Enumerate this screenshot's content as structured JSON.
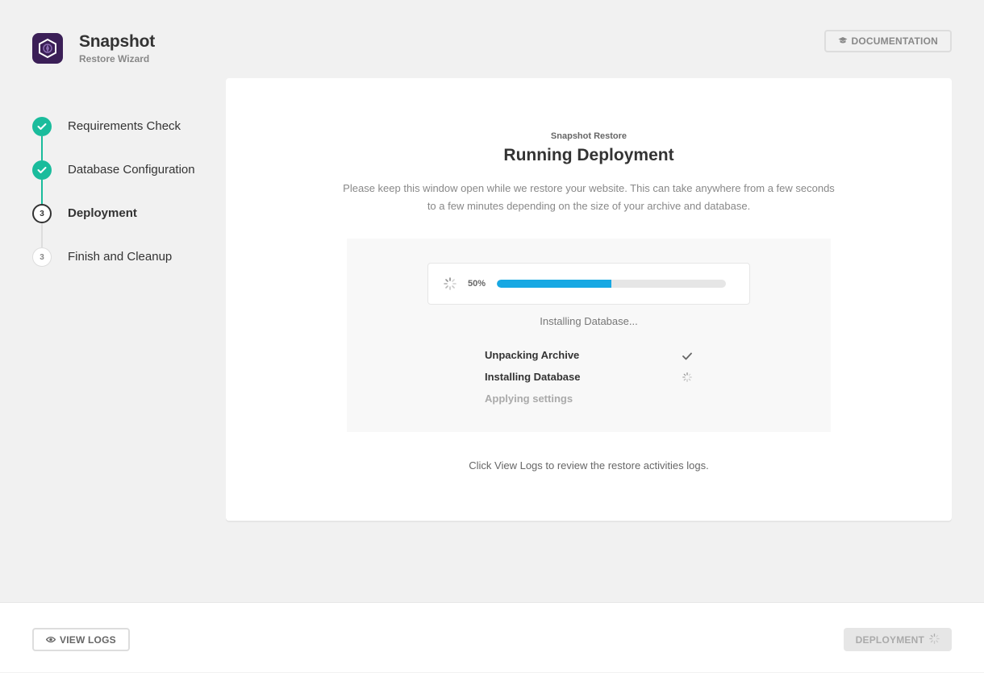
{
  "brand": {
    "name": "Snapshot",
    "subtitle": "Restore Wizard",
    "logo_icon": "snapshot-logo-icon",
    "logo_color": "#3b1f57"
  },
  "header": {
    "documentation_label": "DOCUMENTATION",
    "documentation_icon": "graduation-cap-icon"
  },
  "steps": [
    {
      "label": "Requirements Check",
      "status": "done",
      "marker": "check"
    },
    {
      "label": "Database Configuration",
      "status": "done",
      "marker": "check"
    },
    {
      "label": "Deployment",
      "status": "current",
      "marker": "3"
    },
    {
      "label": "Finish and Cleanup",
      "status": "pending",
      "marker": "3"
    }
  ],
  "main": {
    "subtitle": "Snapshot Restore",
    "title": "Running Deployment",
    "description": "Please keep this window open while we restore your website. This can take anywhere from a few seconds to a few minutes depending on the size of your archive and database.",
    "progress": {
      "percent_label": "50%",
      "percent": 50,
      "status_text": "Installing Database...",
      "color": "#17a8e3"
    },
    "tasks": [
      {
        "label": "Unpacking Archive",
        "status": "done",
        "icon": "checkmark-icon"
      },
      {
        "label": "Installing Database",
        "status": "in-progress",
        "icon": "spinner-icon"
      },
      {
        "label": "Applying settings",
        "status": "pending",
        "icon": ""
      }
    ],
    "footer_text": "Click View Logs to review the restore activities logs."
  },
  "footer": {
    "view_logs_label": "VIEW LOGS",
    "view_logs_icon": "eye-icon",
    "deployment_label": "DEPLOYMENT",
    "deployment_icon": "spinner-icon"
  },
  "colors": {
    "accent_green": "#1abc9c",
    "progress_blue": "#17a8e3",
    "background": "#f1f1f1"
  }
}
